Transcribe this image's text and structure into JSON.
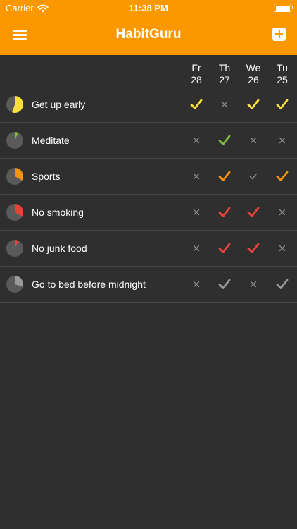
{
  "status_bar": {
    "carrier": "Carrier",
    "time": "11:38 PM"
  },
  "nav": {
    "title": "HabitGuru",
    "menu_icon": "hamburger-menu-icon",
    "add_icon": "plus-square-icon"
  },
  "days": [
    {
      "name": "Fr",
      "num": "28"
    },
    {
      "name": "Th",
      "num": "27"
    },
    {
      "name": "We",
      "num": "26"
    },
    {
      "name": "Tu",
      "num": "25"
    }
  ],
  "colors": {
    "accent": "#fb9800",
    "background": "#2f2f2f",
    "pie_base": "#5a5a5a",
    "cross": "#8a8a8a",
    "skip_check": "#9a9a9a"
  },
  "habits": [
    {
      "name": "Get up early",
      "color": "#ffe03a",
      "progress": 0.55,
      "marks": [
        "done",
        "missed",
        "done",
        "done"
      ]
    },
    {
      "name": "Meditate",
      "color": "#7dbb42",
      "progress": 0.07,
      "marks": [
        "missed",
        "done",
        "missed",
        "missed"
      ]
    },
    {
      "name": "Sports",
      "color": "#f7940f",
      "progress": 0.33,
      "marks": [
        "missed",
        "done",
        "skipped",
        "done"
      ]
    },
    {
      "name": "No smoking",
      "color": "#e8433b",
      "progress": 0.33,
      "marks": [
        "missed",
        "done",
        "done",
        "missed"
      ]
    },
    {
      "name": "No junk food",
      "color": "#e8433b",
      "progress": 0.08,
      "marks": [
        "missed",
        "done",
        "done",
        "missed"
      ]
    },
    {
      "name": "Go to bed before midnight",
      "color": "#9a9a9a",
      "progress": 0.3,
      "marks": [
        "missed",
        "done",
        "missed",
        "done"
      ]
    }
  ]
}
